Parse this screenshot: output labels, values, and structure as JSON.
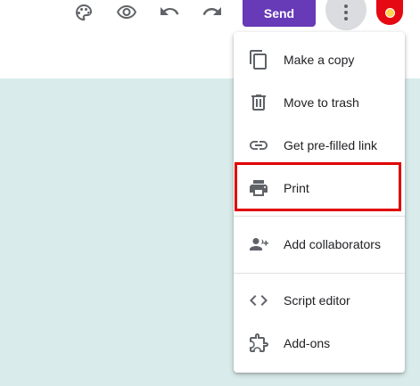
{
  "toolbar": {
    "icons": [
      {
        "name": "palette-icon"
      },
      {
        "name": "preview-eye-icon"
      },
      {
        "name": "undo-icon"
      },
      {
        "name": "redo-icon"
      }
    ],
    "send_label": "Send",
    "more_icon": "more-vert-icon",
    "accent_color": "#673ab7"
  },
  "canvas": {
    "background_color": "#d9eceb"
  },
  "menu": {
    "items": [
      {
        "label": "Make a copy",
        "icon": "copy-icon"
      },
      {
        "label": "Move to trash",
        "icon": "trash-icon"
      },
      {
        "label": "Get pre-filled link",
        "icon": "link-icon"
      },
      {
        "label": "Print",
        "icon": "print-icon",
        "highlighted": true
      },
      {
        "label": "Add collaborators",
        "icon": "add-collaborators-icon"
      },
      {
        "label": "Script editor",
        "icon": "code-icon"
      },
      {
        "label": "Add-ons",
        "icon": "puzzle-icon"
      }
    ],
    "highlight_color": "#e00000"
  }
}
